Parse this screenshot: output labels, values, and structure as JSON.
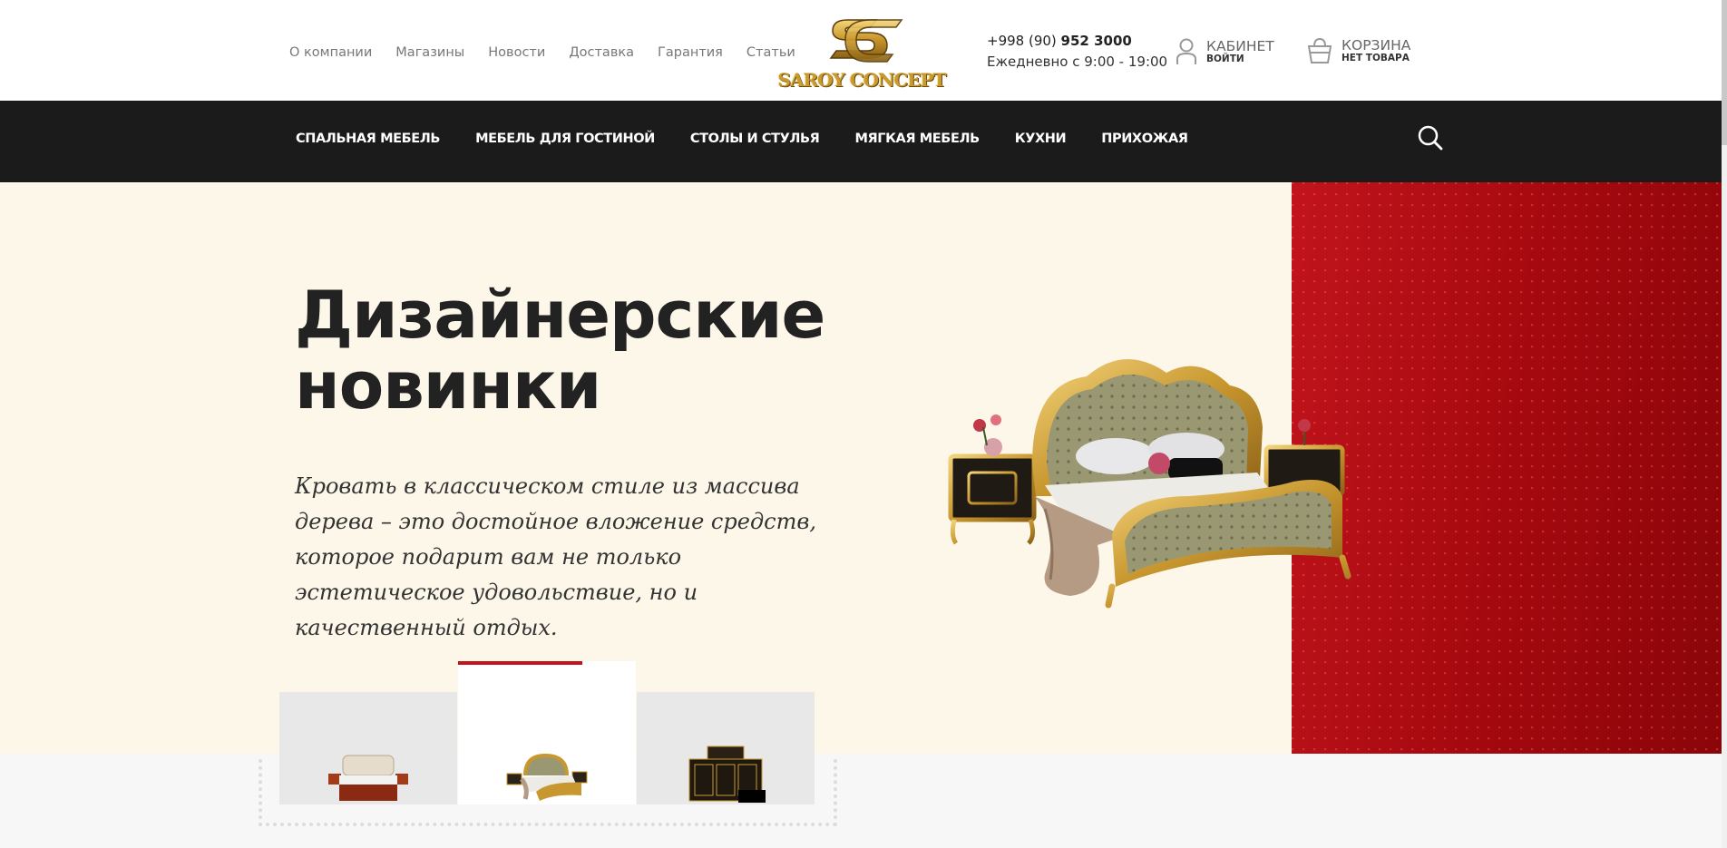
{
  "header": {
    "links": [
      "О компании",
      "Магазины",
      "Новости",
      "Доставка",
      "Гарантия",
      "Статьи"
    ],
    "logo_text": "SAROY CONCEPT",
    "phone_prefix": "+998 (90)",
    "phone_number": "952 3000",
    "hours": "Ежедневно с 9:00 - 19:00",
    "account": {
      "title": "Кабинет",
      "sub": "войти",
      "icon": "user-icon"
    },
    "cart": {
      "title": "Корзина",
      "sub": "нет товара",
      "icon": "basket-icon"
    }
  },
  "nav": {
    "items": [
      "Спальная мебель",
      "Мебель для гостиной",
      "Столы и стулья",
      "Мягкая мебель",
      "Кухни",
      "Прихожая"
    ],
    "search_icon": "search-icon"
  },
  "hero": {
    "title_line1": "Дизайнерские",
    "title_line2": "новинки",
    "description": "Кровать в классическом стиле из массива дерева – это достойное вложение средств, которое подарит вам не только эстетическое удовольствие, но и качественный отдых."
  },
  "slider": {
    "active_index": 1,
    "thumbs": [
      "modern-bed-thumb",
      "classic-gold-bed-thumb",
      "dark-cabinet-thumb"
    ]
  },
  "colors": {
    "accent": "#c2141c",
    "nav_bg": "#1b1b1b",
    "hero_bg": "#fdf7ea",
    "gold": "#c99a2e"
  }
}
